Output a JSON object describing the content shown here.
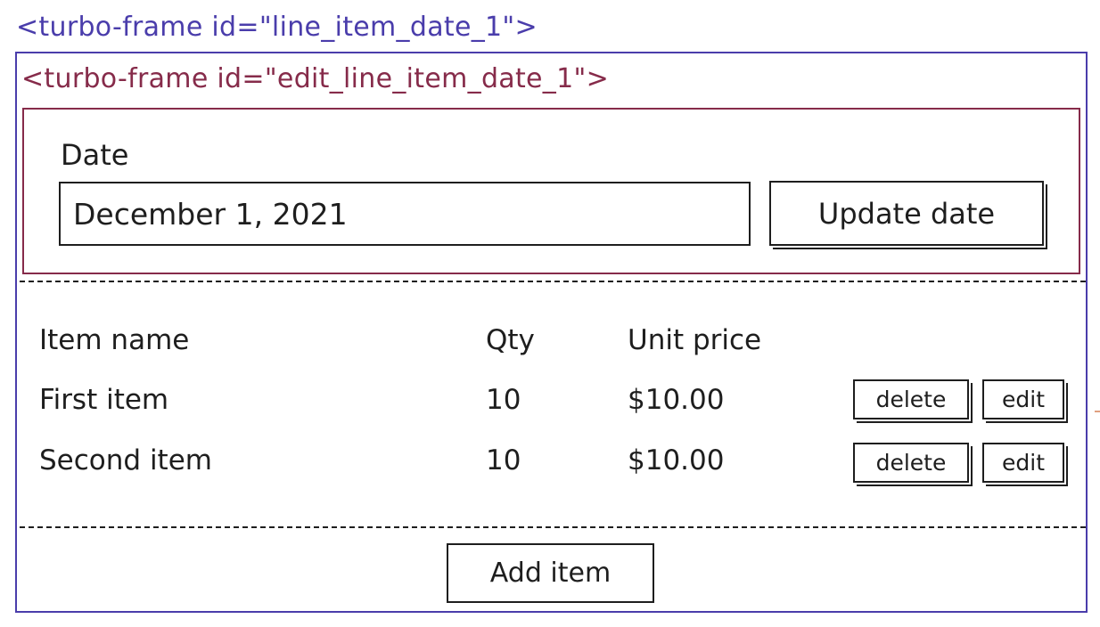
{
  "diagram": {
    "outer_frame_label": "<turbo-frame id=\"line_item_date_1\">",
    "inner_frame_label": "<turbo-frame id=\"edit_line_item_date_1\">",
    "colors": {
      "outer_frame": "#4a3dab",
      "inner_frame": "#862b4a",
      "ink": "#1e1e1e"
    }
  },
  "date_form": {
    "label": "Date",
    "value": "December 1, 2021",
    "submit_label": "Update date"
  },
  "table": {
    "headers": [
      "Item name",
      "Qty",
      "Unit price"
    ],
    "rows": [
      {
        "name": "First item",
        "qty": "10",
        "price": "$10.00",
        "delete_label": "delete",
        "edit_label": "edit"
      },
      {
        "name": "Second item",
        "qty": "10",
        "price": "$10.00",
        "delete_label": "delete",
        "edit_label": "edit"
      }
    ]
  },
  "footer": {
    "add_item_label": "Add item"
  }
}
